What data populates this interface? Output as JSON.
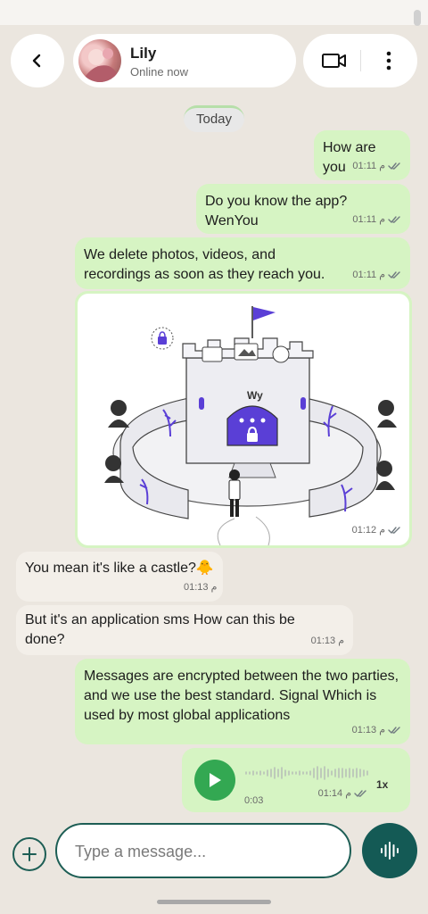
{
  "colors": {
    "outgoing": "#d6f4c3",
    "incoming": "#f3efe9",
    "accent": "#145a55",
    "play": "#33a852",
    "background": "#ebe6df"
  },
  "header": {
    "back_icon": "chevron-left-icon",
    "contact_name": "Lily",
    "contact_status": "Online now",
    "video_icon": "video-camera-icon",
    "more_icon": "more-vertical-icon"
  },
  "chat": {
    "date_label": "Today",
    "messages": [
      {
        "direction": "out",
        "text": "How are you",
        "time": "01:11 م",
        "status": "read"
      },
      {
        "direction": "out",
        "text": "Do you know the app? WenYou",
        "time": "01:11 م",
        "status": "read"
      },
      {
        "direction": "out",
        "text": "We delete photos, videos, and recordings as soon as they reach you.",
        "time": "01:11 م",
        "status": "read"
      },
      {
        "direction": "out",
        "type": "image",
        "image_icon": "castle-illustration",
        "time": "01:12 م",
        "status": "read"
      },
      {
        "direction": "in",
        "text": "You mean it's like a castle?🐥",
        "time": "01:13 م"
      },
      {
        "direction": "in",
        "text": "But it's an application sms How can this be done?",
        "time": "01:13 م"
      },
      {
        "direction": "out",
        "text": "Messages are encrypted between the two parties, and we use the best standard. Signal Which is used by most global applications",
        "time": "01:13 م",
        "status": "read"
      },
      {
        "direction": "out",
        "type": "voice",
        "duration": "0:03",
        "speed": "1x",
        "time": "01:14 م",
        "status": "read",
        "progress": 0
      }
    ]
  },
  "composer": {
    "add_icon": "plus-icon",
    "placeholder": "Type a message...",
    "value": "",
    "voice_icon": "voice-wave-icon"
  }
}
